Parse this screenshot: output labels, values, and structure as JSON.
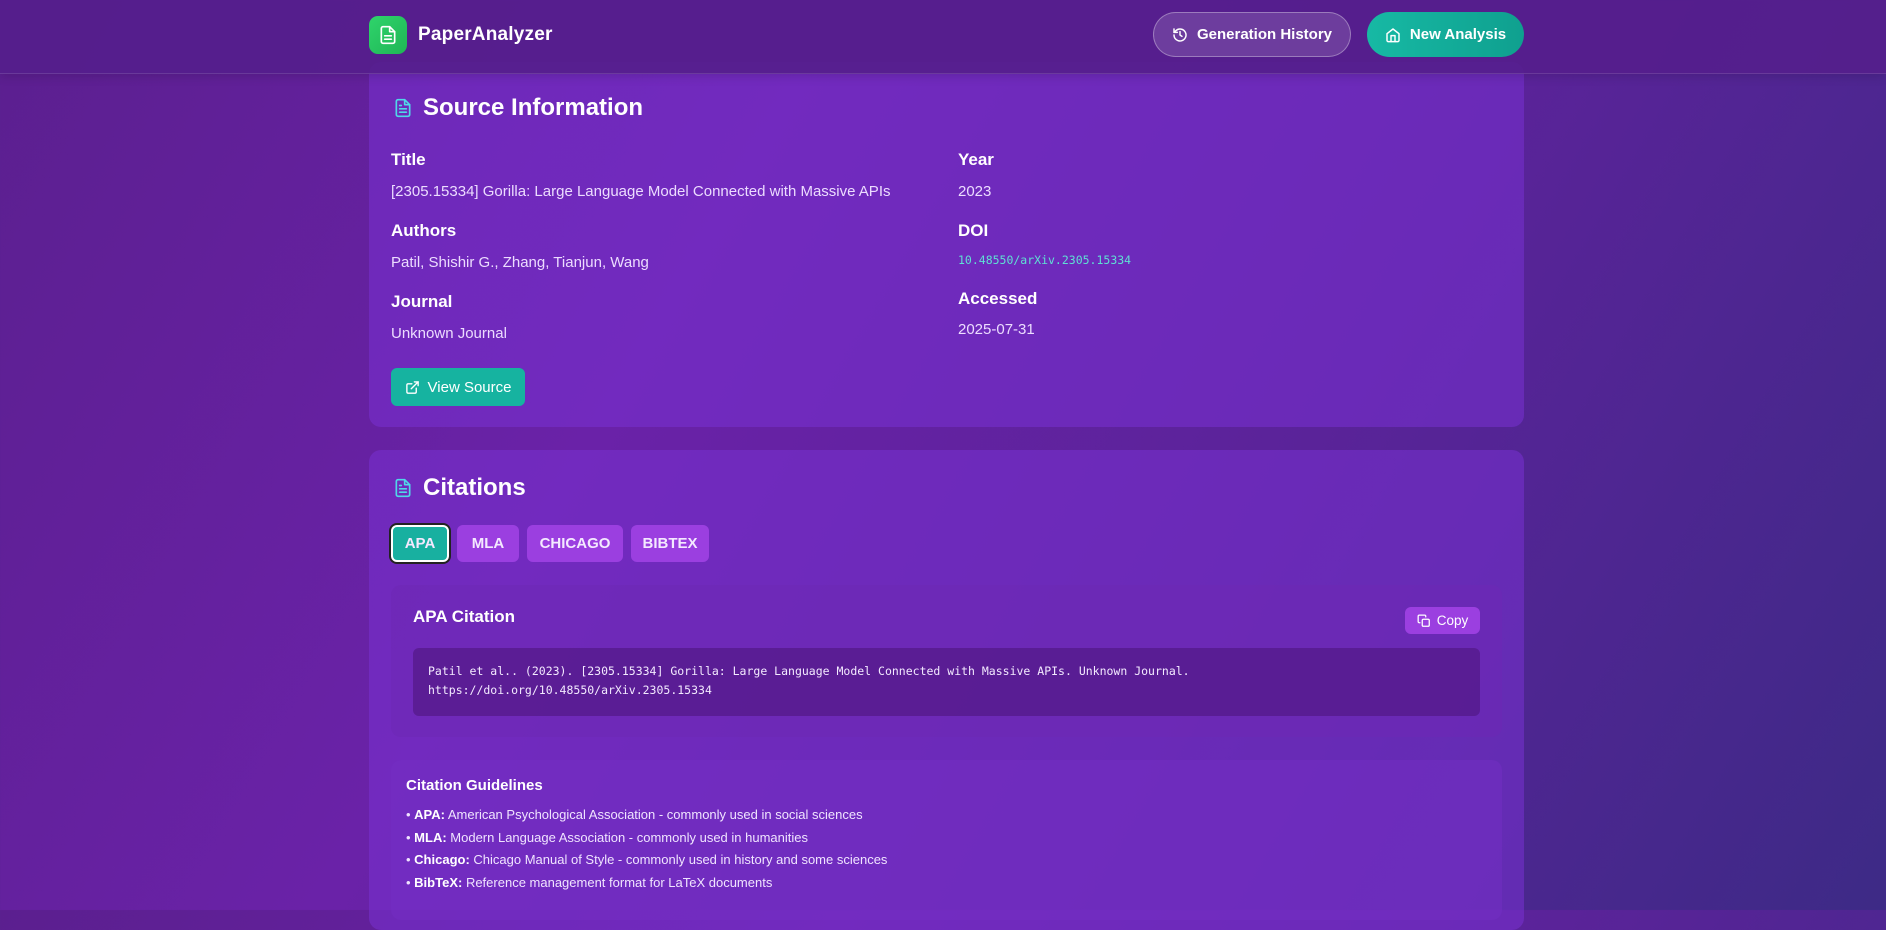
{
  "header": {
    "app_name": "PaperAnalyzer",
    "history_label": "Generation History",
    "new_label": "New Analysis"
  },
  "source": {
    "title": "Source Information",
    "fields": {
      "title_label": "Title",
      "title_value": "[2305.15334] Gorilla: Large Language Model Connected with Massive APIs",
      "authors_label": "Authors",
      "authors_value": "Patil, Shishir G., Zhang, Tianjun, Wang",
      "journal_label": "Journal",
      "journal_value": "Unknown Journal",
      "year_label": "Year",
      "year_value": "2023",
      "doi_label": "DOI",
      "doi_value": "10.48550/arXiv.2305.15334",
      "accessed_label": "Accessed",
      "accessed_value": "2025-07-31"
    },
    "view_button": "View Source"
  },
  "citations": {
    "title": "Citations",
    "tabs": [
      "APA",
      "MLA",
      "CHICAGO",
      "BIBTEX"
    ],
    "active_tab": "APA",
    "panel_title": "APA Citation",
    "copy_label": "Copy",
    "citation_line1": "Patil et al.. (2023). [2305.15334] Gorilla: Large Language Model Connected with Massive APIs. Unknown Journal.",
    "citation_line2": "https://doi.org/10.48550/arXiv.2305.15334",
    "guidelines": {
      "title": "Citation Guidelines",
      "items": [
        {
          "name": "APA:",
          "desc": " American Psychological Association - commonly used in social sciences"
        },
        {
          "name": "MLA:",
          "desc": " Modern Language Association - commonly used in humanities"
        },
        {
          "name": "Chicago:",
          "desc": " Chicago Manual of Style - commonly used in history and some sciences"
        },
        {
          "name": "BibTeX:",
          "desc": " Reference management format for LaTeX documents"
        }
      ]
    }
  },
  "colors": {
    "accent_teal": "#16b3a0",
    "brand_green": "#2fd46b",
    "tab_purple": "#9b3fe0"
  }
}
